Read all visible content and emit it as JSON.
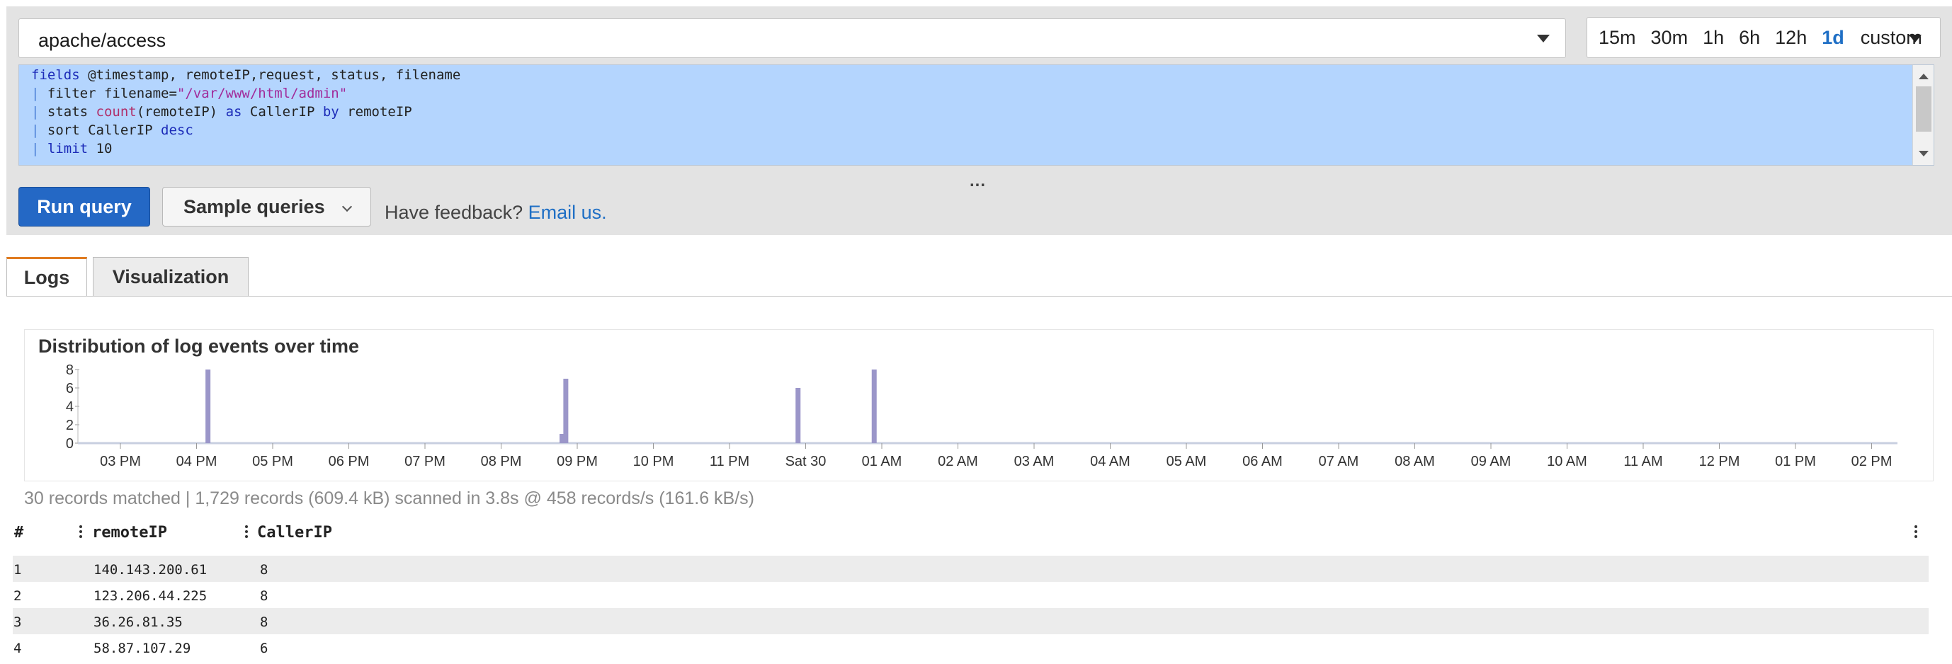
{
  "query_bar": {
    "log_group": "apache/access",
    "time_ranges": [
      "15m",
      "30m",
      "1h",
      "6h",
      "12h",
      "1d"
    ],
    "active_range": "1d",
    "custom_label": "custom",
    "query_lines": [
      [
        {
          "t": "fields",
          "c": "kw"
        },
        {
          "t": " @timestamp, remoteIP,request, status, filename",
          "c": ""
        }
      ],
      [
        {
          "t": "| ",
          "c": "bar"
        },
        {
          "t": "filter",
          "c": ""
        },
        {
          "t": " filename=",
          "c": ""
        },
        {
          "t": "\"/var/www/html/admin\"",
          "c": "str"
        }
      ],
      [
        {
          "t": "| ",
          "c": "bar"
        },
        {
          "t": "stats ",
          "c": ""
        },
        {
          "t": "count",
          "c": "fn"
        },
        {
          "t": "(remoteIP) ",
          "c": ""
        },
        {
          "t": "as",
          "c": "kw"
        },
        {
          "t": " CallerIP ",
          "c": ""
        },
        {
          "t": "by",
          "c": "kw"
        },
        {
          "t": " remoteIP",
          "c": ""
        }
      ],
      [
        {
          "t": "| ",
          "c": "bar"
        },
        {
          "t": "sort",
          "c": ""
        },
        {
          "t": " CallerIP ",
          "c": ""
        },
        {
          "t": "desc",
          "c": "kw"
        }
      ],
      [
        {
          "t": "| ",
          "c": "bar"
        },
        {
          "t": "limit",
          "c": "kw"
        },
        {
          "t": " 10",
          "c": ""
        }
      ]
    ],
    "resize_handle": "...",
    "run_button": "Run query",
    "samples_button": "Sample queries",
    "feedback_text": "Have feedback?",
    "feedback_link": "Email us."
  },
  "tabs": {
    "logs": "Logs",
    "visualization": "Visualization"
  },
  "chart_data": {
    "type": "bar",
    "title": "Distribution of log events over time",
    "y_ticks": [
      "8",
      "6",
      "4",
      "2",
      "0"
    ],
    "ylim": [
      0,
      8
    ],
    "x_tick_labels": [
      "03 PM",
      "04 PM",
      "05 PM",
      "06 PM",
      "07 PM",
      "08 PM",
      "09 PM",
      "10 PM",
      "11 PM",
      "Sat 30",
      "01 AM",
      "02 AM",
      "03 AM",
      "04 AM",
      "05 AM",
      "06 AM",
      "07 AM",
      "08 AM",
      "09 AM",
      "10 AM",
      "11 AM",
      "12 PM",
      "01 PM",
      "02 PM"
    ],
    "bars": [
      {
        "hour_offset": 1.35,
        "value": 8
      },
      {
        "hour_offset": 6.0,
        "value": 1
      },
      {
        "hour_offset": 6.05,
        "value": 7
      },
      {
        "hour_offset": 9.1,
        "value": 6
      },
      {
        "hour_offset": 10.1,
        "value": 8
      }
    ],
    "color": "#9b96c9"
  },
  "summary": "30 records matched | 1,729 records (609.4 kB) scanned in 3.8s @ 458 records/s (161.6 kB/s)",
  "table": {
    "headers": {
      "index": "#",
      "remote_ip": "remoteIP",
      "caller_ip": "CallerIP"
    },
    "rows": [
      {
        "index": "1",
        "remote_ip": "140.143.200.61",
        "caller_ip": "8"
      },
      {
        "index": "2",
        "remote_ip": "123.206.44.225",
        "caller_ip": "8"
      },
      {
        "index": "3",
        "remote_ip": "36.26.81.35",
        "caller_ip": "8"
      },
      {
        "index": "4",
        "remote_ip": "58.87.107.29",
        "caller_ip": "6"
      }
    ]
  }
}
